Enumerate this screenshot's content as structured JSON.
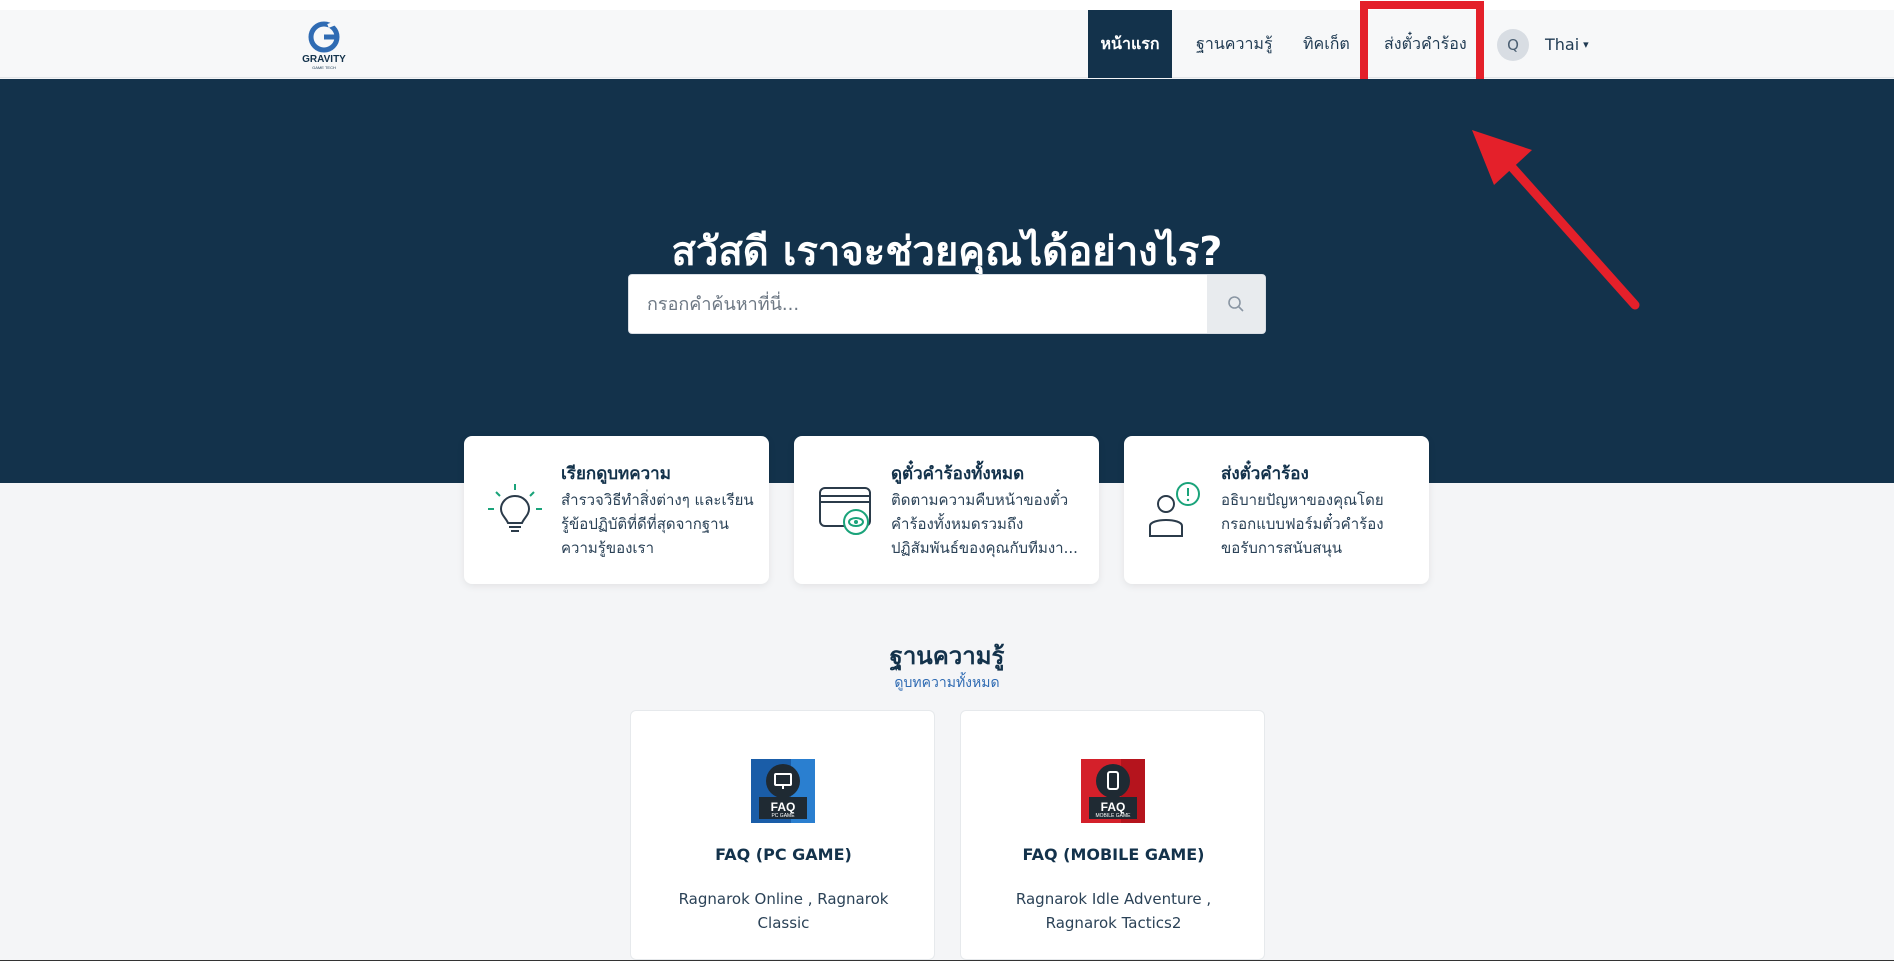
{
  "header": {
    "logo_text": "GRAVITY",
    "logo_subtext": "GAME TECH",
    "nav": {
      "home": "หน้าแรก",
      "knowledge_base": "ฐานความรู้",
      "tickets": "ทิคเก็ต",
      "submit_request": "ส่งตั๋วคำร้อง"
    },
    "avatar_initial": "Q",
    "language": "Thai",
    "language_caret": "▾"
  },
  "hero": {
    "title": "สวัสดี เราจะช่วยคุณได้อย่างไร?",
    "search_placeholder": "กรอกคำค้นหาที่นี่..."
  },
  "cards": [
    {
      "title": "เรียกดูบทความ",
      "description": "สำรวจวิธีทำสิ่งต่างๆ และเรียนรู้ข้อปฏิบัติที่ดีที่สุดจากฐานความรู้ของเรา",
      "icon": "lightbulb-icon"
    },
    {
      "title": "ดูตั๋วคำร้องทั้งหมด",
      "description": "ติดตามความคืบหน้าของตั๋วคำร้องทั้งหมดรวมถึงปฏิสัมพันธ์ของคุณกับทีมงา...",
      "icon": "tickets-eye-icon"
    },
    {
      "title": "ส่งตั๋วคำร้อง",
      "description": "อธิบายปัญหาของคุณโดยกรอกแบบฟอร์มตั๋วคำร้องขอรับการสนับสนุน",
      "icon": "person-alert-icon"
    }
  ],
  "knowledge_base": {
    "title": "ฐานความรู้",
    "browse_link": "ดูบทความทั้งหมด",
    "categories": [
      {
        "title": "FAQ (PC GAME)",
        "description": "Ragnarok Online , Ragnarok Classic",
        "badge": "FAQ",
        "badge_sub": "PC GAME",
        "color": "#1a5da8"
      },
      {
        "title": "FAQ (MOBILE GAME)",
        "description": "Ragnarok Idle Adventure , Ragnarok Tactics2",
        "badge": "FAQ",
        "badge_sub": "MOBILE GAME",
        "color": "#d4202a"
      }
    ]
  },
  "colors": {
    "primary": "#13324b",
    "accent": "#1aa37a",
    "highlight": "#e4202a"
  }
}
